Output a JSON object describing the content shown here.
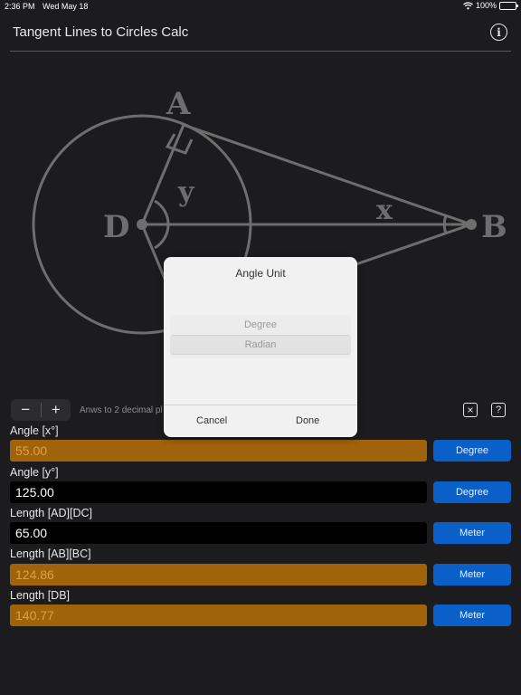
{
  "status_bar": {
    "time": "2:36 PM",
    "date": "Wed May 18",
    "battery": "100%"
  },
  "nav": {
    "title": "Tangent Lines to Circles Calc",
    "info_icon": "info-icon",
    "info_glyph": "i"
  },
  "diagram": {
    "labels": {
      "a": "A",
      "b": "B",
      "d": "D",
      "x": "x",
      "y": "y"
    }
  },
  "toolbar": {
    "minus_label": "−",
    "plus_label": "+",
    "decimal_note": "Anws to 2 decimal pl",
    "clear_glyph": "×",
    "help_glyph": "?"
  },
  "fields": [
    {
      "label": "Angle [x°]",
      "value": "55.00",
      "unit": "Degree",
      "kind": "result"
    },
    {
      "label": "Angle [y°]",
      "value": "125.00",
      "unit": "Degree",
      "kind": "entry"
    },
    {
      "label": "Length [AD][DC]",
      "value": "65.00",
      "unit": "Meter",
      "kind": "entry"
    },
    {
      "label": "Length [AB][BC]",
      "value": "124.86",
      "unit": "Meter",
      "kind": "result"
    },
    {
      "label": "Length [DB]",
      "value": "140.77",
      "unit": "Meter",
      "kind": "result"
    }
  ],
  "dialog": {
    "title": "Angle Unit",
    "options": [
      "Degree",
      "Radian"
    ],
    "selected": "Radian",
    "cancel_label": "Cancel",
    "done_label": "Done"
  },
  "colors": {
    "background": "#1c1c1e",
    "result_field": "#a0620a",
    "result_text": "#e0a040",
    "unit_button": "#0a60c8",
    "diagram_stroke": "#6e6e6e"
  }
}
